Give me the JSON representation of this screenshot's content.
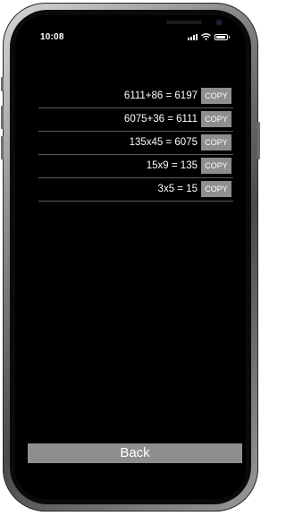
{
  "status_bar": {
    "time": "10:08",
    "signal_icon": "cellular-signal-icon",
    "wifi_icon": "wifi-icon",
    "battery_icon": "battery-icon"
  },
  "history": {
    "copy_label": "COPY",
    "items": [
      {
        "expression": "6111+86 = 6197"
      },
      {
        "expression": "6075+36 = 6111"
      },
      {
        "expression": "135x45 = 6075"
      },
      {
        "expression": "15x9 = 135"
      },
      {
        "expression": "3x5 = 15"
      }
    ]
  },
  "footer": {
    "back_label": "Back"
  },
  "colors": {
    "background": "#000000",
    "button": "#8e8e8e",
    "text": "#ffffff",
    "divider": "#5a5a5a"
  }
}
